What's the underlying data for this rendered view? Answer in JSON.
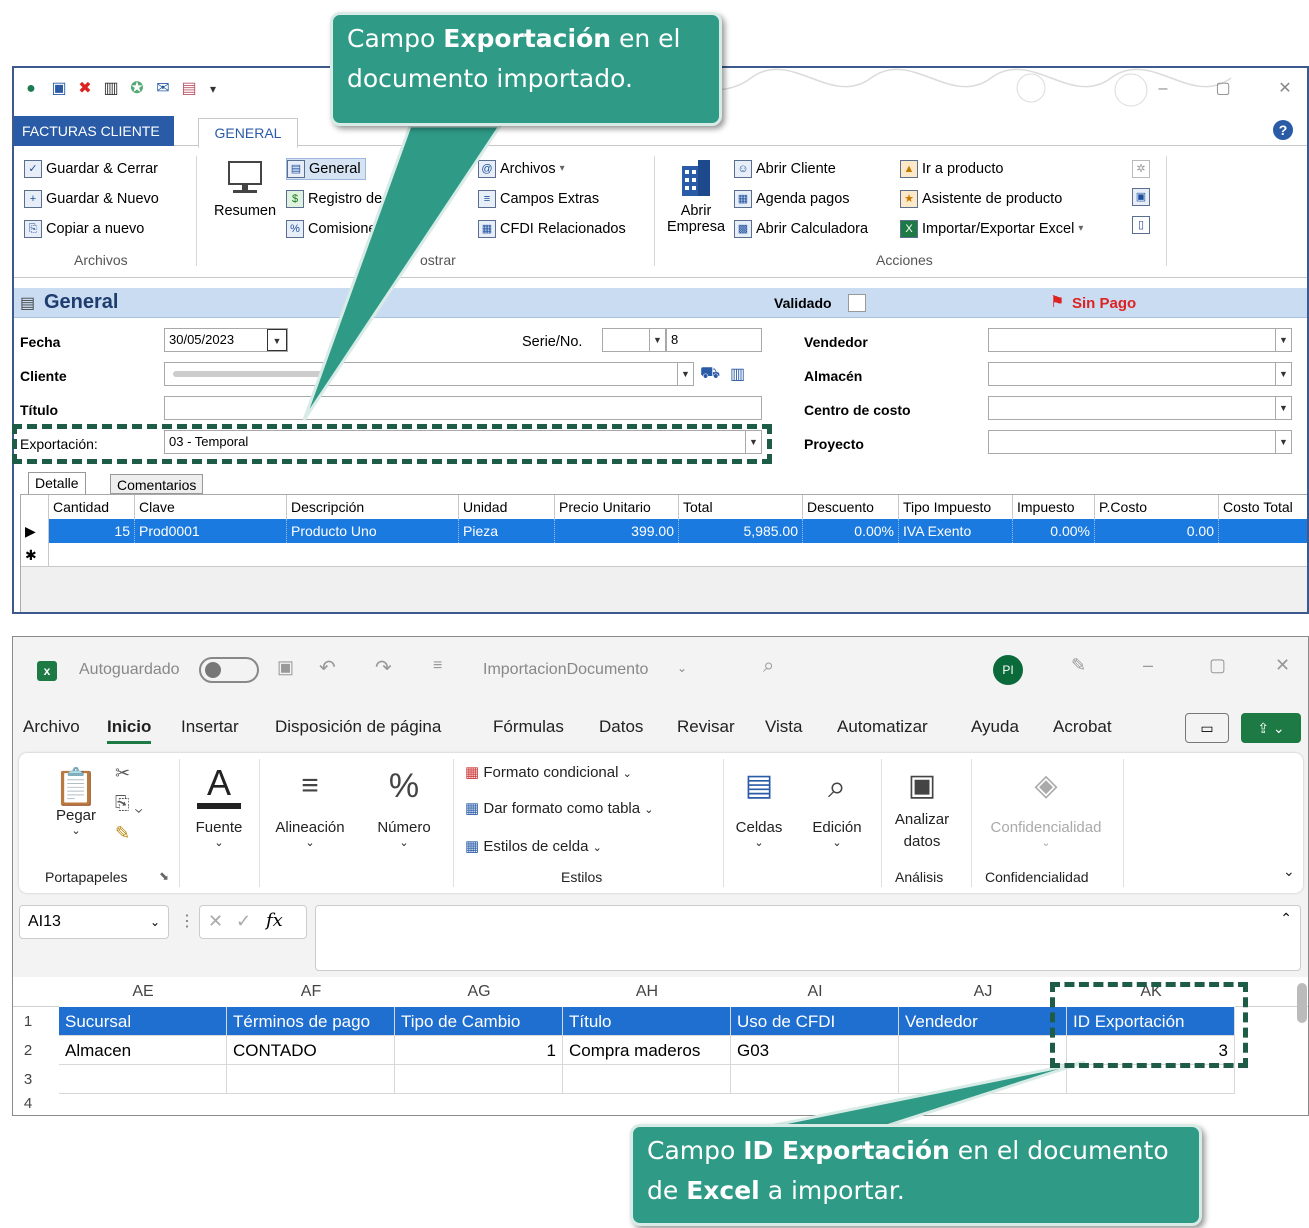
{
  "top_app": {
    "ribbon_tabs": {
      "facturas": "FACTURAS CLIENTE",
      "general": "GENERAL"
    },
    "ribbon": {
      "archivos_group": {
        "guardar_cerrar": "Guardar & Cerrar",
        "guardar_nuevo": "Guardar & Nuevo",
        "copiar_nuevo": "Copiar a nuevo",
        "label": "Archivos"
      },
      "mostrar_group": {
        "resumen": "Resumen",
        "general": "General",
        "registro_pagos": "Registro de pagos",
        "comisiones": "Comisiones",
        "archivos": "Archivos",
        "campos_extras": "Campos Extras",
        "cfdi_relacionados": "CFDI Relacionados",
        "label": "ostrar"
      },
      "acciones_group": {
        "abrir_empresa_1": "Abrir",
        "abrir_empresa_2": "Empresa",
        "abrir_cliente": "Abrir Cliente",
        "agenda_pagos": "Agenda pagos",
        "abrir_calculadora": "Abrir Calculadora",
        "ir_producto": "Ir a producto",
        "asistente_producto": "Asistente de producto",
        "importar_exportar": "Importar/Exportar Excel",
        "label": "Acciones"
      }
    },
    "section_title": "General",
    "validado_label": "Validado",
    "sin_pago_label": "Sin Pago",
    "form": {
      "fecha_label": "Fecha",
      "fecha_value": "30/05/2023",
      "serie_label": "Serie/No.",
      "serie_value": "",
      "no_value": "8",
      "cliente_label": "Cliente",
      "titulo_label": "Título",
      "exportacion_label": "Exportación:",
      "exportacion_value": "03 - Temporal",
      "vendedor_label": "Vendedor",
      "almacen_label": "Almacén",
      "centro_label": "Centro de costo",
      "proyecto_label": "Proyecto"
    },
    "grid_tabs": {
      "detalle": "Detalle",
      "comentarios": "Comentarios"
    },
    "grid_columns": [
      "Cantidad",
      "Clave",
      "Descripción",
      "Unidad",
      "Precio Unitario",
      "Total",
      "Descuento",
      "Tipo Impuesto",
      "Impuesto",
      "P.Costo",
      "Costo Total"
    ],
    "grid_row": [
      "15",
      "Prod0001",
      "Producto Uno",
      "Pieza",
      "399.00",
      "5,985.00",
      "0.00%",
      "IVA Exento",
      "0.00%",
      "0.00",
      ""
    ]
  },
  "excel": {
    "autosave_label": "Autoguardado",
    "file_name": "ImportacionDocumento",
    "avatar_initials": "PI",
    "menu": [
      "Archivo",
      "Inicio",
      "Insertar",
      "Disposición de página",
      "Fórmulas",
      "Datos",
      "Revisar",
      "Vista",
      "Automatizar",
      "Ayuda",
      "Acrobat"
    ],
    "ribbon": {
      "pegar": "Pegar",
      "portapapeles": "Portapapeles",
      "fuente": "Fuente",
      "alineacion": "Alineación",
      "numero": "Número",
      "formato_condicional": "Formato condicional",
      "dar_formato": "Dar formato como tabla",
      "estilos_celda": "Estilos de celda",
      "estilos": "Estilos",
      "celdas": "Celdas",
      "edicion": "Edición",
      "analizar_1": "Analizar",
      "analizar_2": "datos",
      "analisis": "Análisis",
      "confidencialidad_btn": "Confidencialidad",
      "confidencialidad": "Confidencialidad"
    },
    "name_box": "AI13",
    "fx": "fx",
    "columns": [
      "AE",
      "AF",
      "AG",
      "AH",
      "AI",
      "AJ",
      "AK"
    ],
    "rows": [
      "1",
      "2",
      "3",
      "4"
    ],
    "header_row": [
      "Sucursal",
      "Términos de pago",
      "Tipo de Cambio",
      "Título",
      "Uso de CFDI",
      "Vendedor",
      "ID Exportación"
    ],
    "data_row": [
      "Almacen",
      "CONTADO",
      "1",
      "Compra maderos",
      "G03",
      "",
      "3"
    ]
  },
  "callouts": {
    "top_1": "Campo",
    "top_bold": "Exportación",
    "top_2": "en el",
    "top_3": "documento importado.",
    "bottom_1": "Campo",
    "bottom_bold": "ID Exportación",
    "bottom_2": "en el documento",
    "bottom_3": "de",
    "bottom_bold2": "Excel",
    "bottom_4": "a importar."
  },
  "colors": {
    "accent_blue": "#2a5ba6",
    "excel_header": "#1f6fd1",
    "callout": "#2f9a86",
    "dash": "#1f5c48"
  }
}
